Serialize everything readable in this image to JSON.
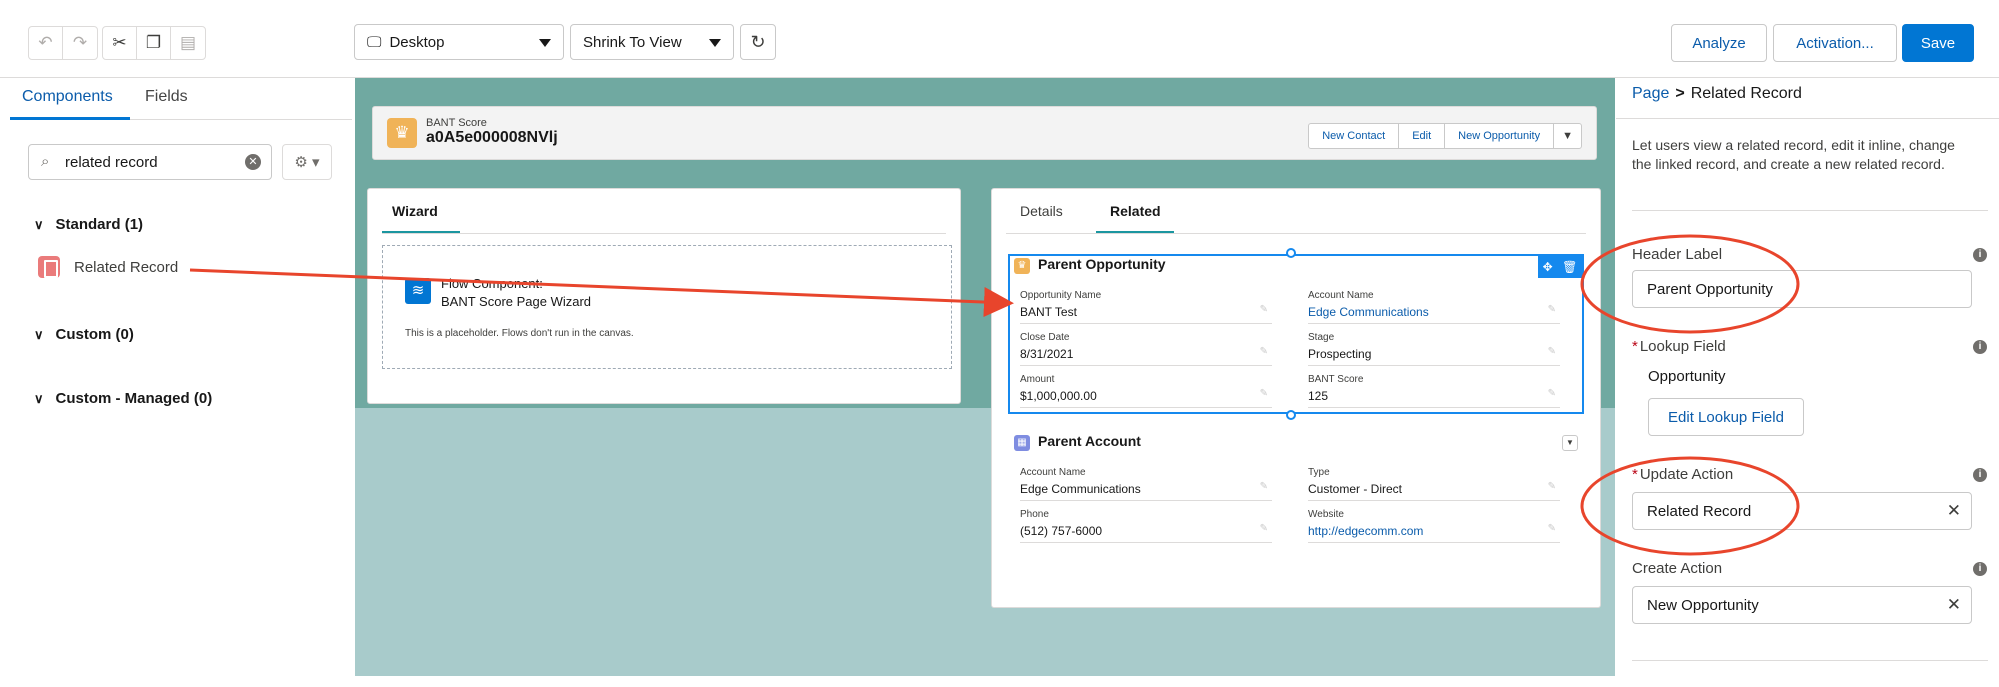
{
  "toolbar": {
    "device_select": "Desktop",
    "view_select": "Shrink To View",
    "analyze": "Analyze",
    "activation": "Activation...",
    "save": "Save"
  },
  "left_panel": {
    "tabs": [
      "Components",
      "Fields"
    ],
    "search": {
      "value": "related record"
    },
    "sections": [
      {
        "label": "Standard (1)"
      },
      {
        "label": "Custom (0)"
      },
      {
        "label": "Custom - Managed (0)"
      }
    ],
    "standard_items": [
      "Related Record"
    ]
  },
  "canvas": {
    "highlights": {
      "object_label": "BANT Score",
      "record_name": "a0A5e000008NVlj",
      "actions": [
        "New Contact",
        "Edit",
        "New Opportunity"
      ]
    },
    "left_card": {
      "tab": "Wizard",
      "flow_title": "Flow Component:",
      "flow_name": "BANT Score Page Wizard",
      "placeholder": "This is a placeholder. Flows don't run in the canvas."
    },
    "right_card": {
      "tabs": [
        "Details",
        "Related"
      ],
      "parent_opportunity": {
        "title": "Parent Opportunity",
        "fields": [
          {
            "label": "Opportunity Name",
            "value": "BANT Test"
          },
          {
            "label": "Account Name",
            "value": "Edge Communications"
          },
          {
            "label": "Close Date",
            "value": "8/31/2021"
          },
          {
            "label": "Stage",
            "value": "Prospecting"
          },
          {
            "label": "Amount",
            "value": "$1,000,000.00"
          },
          {
            "label": "BANT Score",
            "value": "125"
          }
        ]
      },
      "parent_account": {
        "title": "Parent Account",
        "fields": [
          {
            "label": "Account Name",
            "value": "Edge Communications"
          },
          {
            "label": "Type",
            "value": "Customer - Direct"
          },
          {
            "label": "Phone",
            "value": "(512) 757-6000"
          },
          {
            "label": "Website",
            "value": "http://edgecomm.com"
          }
        ]
      }
    }
  },
  "right_panel": {
    "breadcrumb": {
      "root": "Page",
      "separator": ">",
      "current": "Related Record"
    },
    "description": "Let users view a related record, edit it inline, change the linked record, and create a new related record.",
    "header_label": {
      "label": "Header Label",
      "value": "Parent Opportunity"
    },
    "lookup_field": {
      "label": "Lookup Field",
      "value": "Opportunity",
      "button": "Edit Lookup Field"
    },
    "update_action": {
      "label": "Update Action",
      "value": "Related Record"
    },
    "create_action": {
      "label": "Create Action",
      "value": "New Opportunity"
    }
  },
  "colors": {
    "brand": "#0176d3",
    "annotation": "#e8452c",
    "canvas_bg": "#a8cbcb",
    "highlight_icon": "#f0b358",
    "component_icon": "#ea7b7b"
  }
}
